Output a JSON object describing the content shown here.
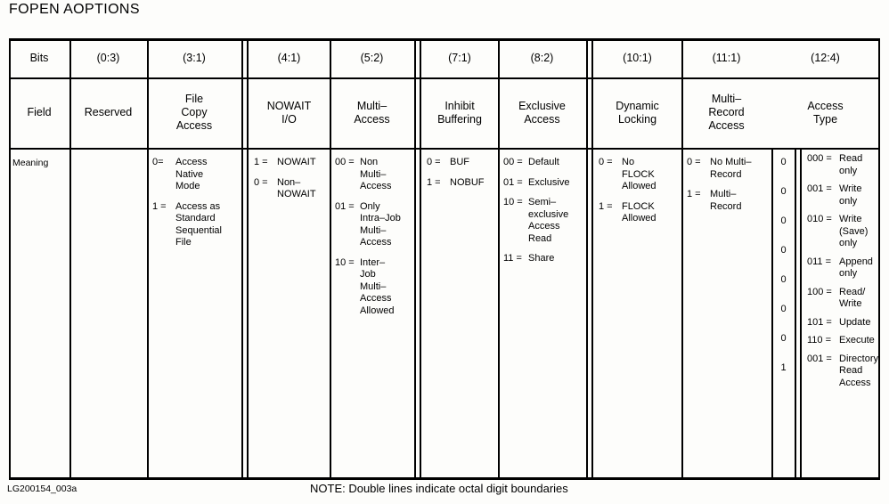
{
  "title": "FOPEN AOPTIONS",
  "row_labels": {
    "bits": "Bits",
    "field": "Field",
    "meaning": "Meaning"
  },
  "columns": [
    {
      "bits": "(0:3)",
      "field": "Reserved",
      "meaning": []
    },
    {
      "bits": "(3:1)",
      "field": "File\nCopy\nAccess",
      "meaning": [
        {
          "code": "0=",
          "value": "Access\nNative\nMode"
        },
        {
          "code": "1 =",
          "value": "Access as\nStandard\nSequential\nFile"
        }
      ]
    },
    {
      "bits": "(4:1)",
      "field": "NOWAIT\nI/O",
      "meaning": [
        {
          "code": "1 =",
          "value": "NOWAIT"
        },
        {
          "code": "0 =",
          "value": "Non–\nNOWAIT"
        }
      ]
    },
    {
      "bits": "(5:2)",
      "field": "Multi–\nAccess",
      "meaning": [
        {
          "code": "00 =",
          "value": "Non\nMulti–\nAccess"
        },
        {
          "code": "01 =",
          "value": "Only\nIntra–Job\nMulti–\nAccess"
        },
        {
          "code": "10 =",
          "value": "Inter–\nJob\nMulti–\nAccess\nAllowed"
        }
      ]
    },
    {
      "bits": "(7:1)",
      "field": "Inhibit\nBuffering",
      "meaning": [
        {
          "code": "0 =",
          "value": "BUF"
        },
        {
          "code": "1 =",
          "value": "NOBUF"
        }
      ]
    },
    {
      "bits": "(8:2)",
      "field": "Exclusive\nAccess",
      "meaning": [
        {
          "code": "00 =",
          "value": "Default"
        },
        {
          "code": "01 =",
          "value": "Exclusive"
        },
        {
          "code": "10 =",
          "value": "Semi–\nexclusive\nAccess\nRead"
        },
        {
          "code": "11 =",
          "value": "Share"
        }
      ]
    },
    {
      "bits": "(10:1)",
      "field": "Dynamic\nLocking",
      "meaning": [
        {
          "code": "0 =",
          "value": "No\nFLOCK\nAllowed"
        },
        {
          "code": "1 =",
          "value": "FLOCK\nAllowed"
        }
      ]
    },
    {
      "bits": "(11:1)",
      "field": "Multi–\nRecord\nAccess",
      "meaning": [
        {
          "code": "0 =",
          "value": "No Multi–\nRecord"
        },
        {
          "code": "1 =",
          "value": "Multi–\nRecord"
        }
      ]
    }
  ],
  "access_type": {
    "bits": "(12:4)",
    "field": "Access\nType",
    "bit_flags": [
      "0",
      "0",
      "0",
      "0",
      "0",
      "0",
      "0",
      "1"
    ],
    "entries": [
      {
        "code": "000 =",
        "value": "Read\nonly"
      },
      {
        "code": "001 =",
        "value": "Write\nonly"
      },
      {
        "code": "010 =",
        "value": "Write\n(Save)\nonly"
      },
      {
        "code": "011 =",
        "value": "Append\nonly"
      },
      {
        "code": "100 =",
        "value": "Read/\nWrite"
      },
      {
        "code": "101 =",
        "value": "Update"
      },
      {
        "code": "110 =",
        "value": "Execute"
      },
      {
        "code": "001 =",
        "value": "Directory\nRead\nAccess"
      }
    ]
  },
  "footer": {
    "figure_id": "LG200154_003a",
    "note": "NOTE: Double lines indicate octal digit boundaries"
  }
}
